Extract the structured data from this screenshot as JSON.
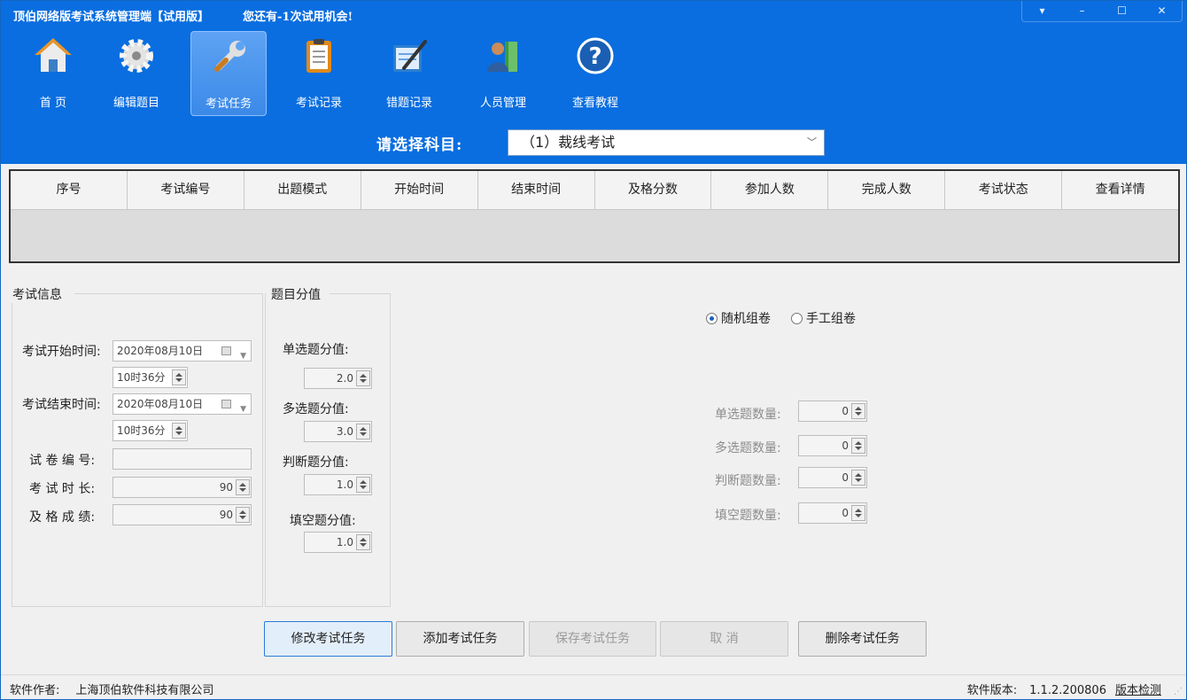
{
  "window": {
    "title": "顶伯网络版考试系统管理端【试用版】",
    "trial_notice": "您还有-1次试用机会!",
    "controls": [
      "▾",
      "–",
      "☐",
      "✕"
    ]
  },
  "toolbar": {
    "items": [
      {
        "label": "首  页",
        "icon": "home-icon"
      },
      {
        "label": "编辑题目",
        "icon": "gear-icon"
      },
      {
        "label": "考试任务",
        "icon": "wrench-icon",
        "active": true
      },
      {
        "label": "考试记录",
        "icon": "clipboard-icon"
      },
      {
        "label": "错题记录",
        "icon": "notebook-icon"
      },
      {
        "label": "人员管理",
        "icon": "people-icon"
      },
      {
        "label": "查看教程",
        "icon": "help-icon"
      }
    ]
  },
  "subject": {
    "label": "请选择科目:",
    "selected": "（1）裁线考试"
  },
  "table": {
    "columns": [
      "序号",
      "考试编号",
      "出题模式",
      "开始时间",
      "结束时间",
      "及格分数",
      "参加人数",
      "完成人数",
      "考试状态",
      "查看详情"
    ]
  },
  "exam_info": {
    "title": "考试信息",
    "start_label": "考试开始时间:",
    "start_date": "2020年08月10日",
    "start_time": "10时36分",
    "end_label": "考试结束时间:",
    "end_date": "2020年08月10日",
    "end_time": "10时36分",
    "paper_no_label": "试 卷 编 号:",
    "paper_no": "",
    "duration_label": "考 试 时 长:",
    "duration": "90",
    "pass_label": "及 格 成 绩:",
    "pass_score": "90"
  },
  "scores": {
    "title": "题目分值",
    "single_label": "单选题分值:",
    "single": "2.0",
    "multi_label": "多选题分值:",
    "multi": "3.0",
    "judge_label": "判断题分值:",
    "judge": "1.0",
    "fill_label": "填空题分值:",
    "fill": "1.0"
  },
  "compose": {
    "random_label": "随机组卷",
    "manual_label": "手工组卷",
    "mode": "random",
    "single_count_label": "单选题数量:",
    "single_count": "0",
    "multi_count_label": "多选题数量:",
    "multi_count": "0",
    "judge_count_label": "判断题数量:",
    "judge_count": "0",
    "fill_count_label": "填空题数量:",
    "fill_count": "0"
  },
  "buttons": {
    "modify": "修改考试任务",
    "add": "添加考试任务",
    "save": "保存考试任务",
    "cancel": "取  消",
    "delete": "删除考试任务"
  },
  "status": {
    "author_label": "软件作者:",
    "company": "上海顶伯软件科技有限公司",
    "version_label": "软件版本:",
    "version": "1.1.2.200806",
    "check_update": "版本检测"
  },
  "colors": {
    "header_blue": "#0a6ee0",
    "active_tab": "#3b89e8",
    "primary_border": "#2a7bd8"
  }
}
